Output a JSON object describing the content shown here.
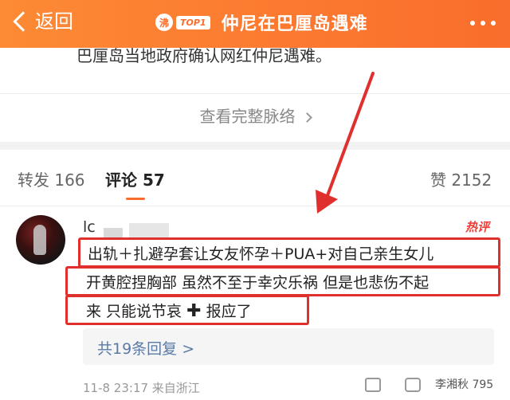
{
  "header": {
    "back_label": "返回",
    "hot_tag": "沸",
    "rank_tag": "TOP1",
    "title": "仲尼在巴厘岛遇难"
  },
  "post": {
    "clipped_text": "巴厘岛当地政府确认网红仲尼遇难。",
    "full_context_label": "查看完整脉络"
  },
  "tabs": [
    {
      "label": "转发",
      "count": "166"
    },
    {
      "label": "评论",
      "count": "57"
    },
    {
      "label": "赞",
      "count": "2152"
    }
  ],
  "comment": {
    "username": "lc",
    "badge": "热评",
    "lines": [
      "出轨＋扎避孕套让女友怀孕＋PUA+对自己亲生女儿",
      "开黄腔捏胸部 虽然不至于幸灾乐祸 但是也悲伤不起",
      "来 只能说节哀",
      "报应了"
    ],
    "plus_glyph": "✚",
    "reply_summary": "共19条回复 >",
    "meta": "11-8 23:17  来自浙江",
    "watermark": "李湘秋",
    "like_count": "795"
  },
  "colors": {
    "header_orange": "#fa6d2c",
    "annotation_red": "#e0302e",
    "link_blue": "#5b7aa6"
  }
}
